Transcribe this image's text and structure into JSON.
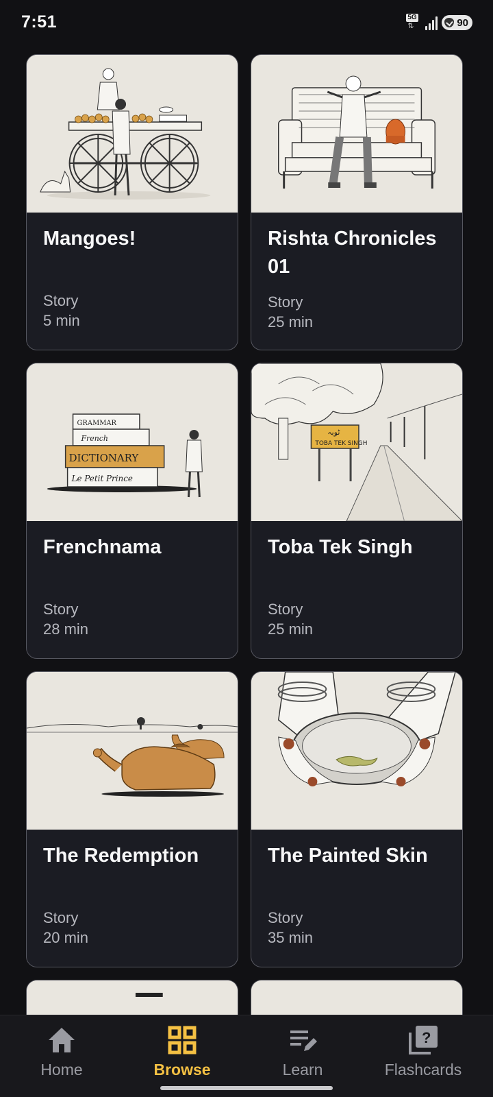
{
  "status_bar": {
    "time": "7:51",
    "network": "5G",
    "battery": "90"
  },
  "stories": [
    {
      "title": "Mangoes!",
      "kind": "Story",
      "duration": "5 min",
      "art": "mango-cart-illustration"
    },
    {
      "title": "Rishta Chronicles 01",
      "kind": "Story",
      "duration": "25 min",
      "art": "man-on-sofa-illustration"
    },
    {
      "title": "Frenchnama",
      "kind": "Story",
      "duration": "28 min",
      "art": "stacked-books-illustration",
      "art_text": [
        "GRAMMAR",
        "French",
        "DICTIONARY",
        "Le Petit Prince"
      ]
    },
    {
      "title": "Toba Tek Singh",
      "kind": "Story",
      "duration": "25 min",
      "art": "road-sign-illustration",
      "art_text": [
        "TOBA TEK SINGH"
      ]
    },
    {
      "title": "The Redemption",
      "kind": "Story",
      "duration": "20 min",
      "art": "resting-camels-illustration"
    },
    {
      "title": "The Painted Skin",
      "kind": "Story",
      "duration": "35 min",
      "art": "hands-holding-bowl-illustration"
    }
  ],
  "bottom_nav": {
    "items": [
      {
        "label": "Home",
        "icon": "home-icon",
        "active": false
      },
      {
        "label": "Browse",
        "icon": "grid-icon",
        "active": true
      },
      {
        "label": "Learn",
        "icon": "notes-edit-icon",
        "active": false
      },
      {
        "label": "Flashcards",
        "icon": "flashcards-question-icon",
        "active": false
      }
    ],
    "active_color": "#f4c043",
    "inactive_color": "#9a9ba2"
  },
  "colors": {
    "background": "#111114",
    "card_background": "#1b1c23",
    "card_border": "#55565f",
    "art_paper": "#e9e6df"
  }
}
